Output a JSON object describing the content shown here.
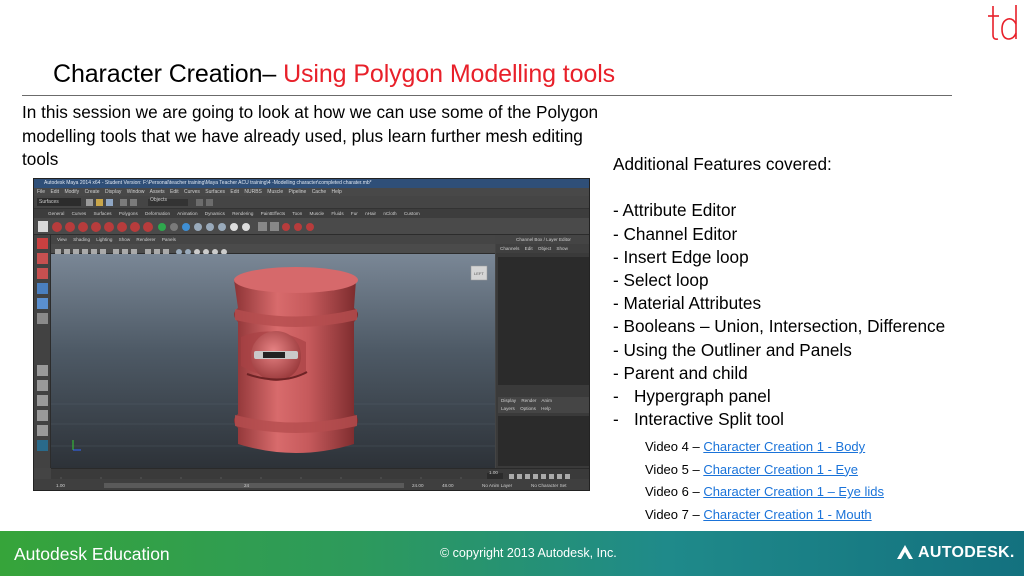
{
  "header": {
    "logo": "td",
    "title_prefix": "Character Creation– ",
    "title_highlight": "Using Polygon Modelling tools"
  },
  "intro_text": "In this session we are going to look at how we can use some of the Polygon modelling tools that we have already used, plus learn further mesh editing tools",
  "features": {
    "heading": "Additional Features covered:",
    "items": [
      "- Attribute Editor",
      "- Channel Editor",
      "- Insert Edge loop",
      "- Select loop",
      "- Material Attributes",
      "- Booleans – Union, Intersection, Difference",
      "- Using the Outliner and Panels",
      "- Parent and child"
    ],
    "subitems": [
      {
        "dash": "-",
        "label": "Hypergraph panel"
      },
      {
        "dash": "-",
        "label": "Interactive Split tool"
      }
    ]
  },
  "videos": [
    {
      "prefix": "Video 4 – ",
      "link": "Character Creation 1 - Body"
    },
    {
      "prefix": "Video 5 – ",
      "link": "Character Creation 1 - Eye"
    },
    {
      "prefix": "Video 6 – ",
      "link": "Character Creation 1 – Eye lids"
    },
    {
      "prefix": "Video 7 – ",
      "link": "Character Creation 1 - Mouth"
    }
  ],
  "footer": {
    "brand": "Autodesk Education",
    "copyright": "© copyright 2013 Autodesk, Inc.",
    "company": "AUTODESK."
  },
  "colors": {
    "accent": "#e8202a",
    "link": "#1a73d9",
    "footer_start": "#36a43a",
    "footer_end": "#13717f",
    "model_body": "#c65a5c"
  },
  "screenshot": {
    "window_title": "Autodesk Maya 2014 x64 - Student Version: F:\\Personal\\teacher training\\Maya Teacher ACU training\\4 -Modelling character\\completed charater.mb*",
    "menus": "File Edit Modify Create Display Window Assets Edit Curves Surfaces Edit NURBS Muscle Pipeline Cache Help",
    "mode": "Surfaces",
    "objects_label": "Objects",
    "shelf_tabs": "General Curves Surfaces Polygons Deformation Animation Dynamics Rendering PaintEffects Toon Muscle Fluids Fur nHair nCloth Custom",
    "panel_menus": "View Shading Lighting Show Renderer Panels",
    "viewcube": "LEFT",
    "channel_box_title": "Channel Box / Layer Editor",
    "channel_tabs": "Channels Edit Object Show",
    "layer_tabs": "Display Render Anim",
    "layer_menus": "Layers Options Help",
    "range_start": "1.00",
    "range_end": "24.00",
    "range_max": "48.00",
    "frame_field": "24",
    "anim_layer": "No Anim Layer",
    "char_set": "No Character Set"
  }
}
